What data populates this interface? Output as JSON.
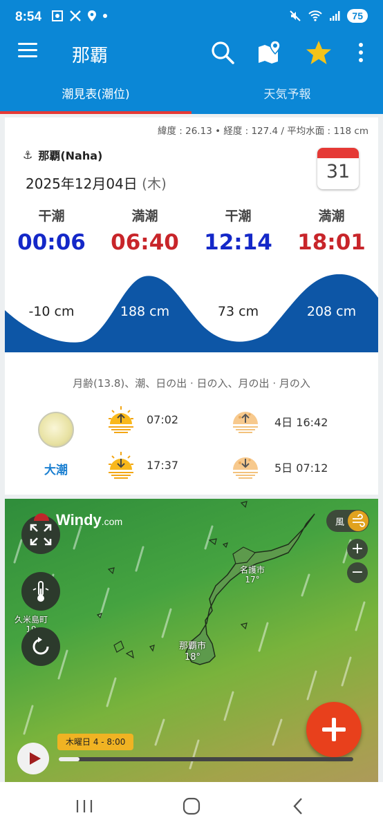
{
  "status_bar": {
    "time": "8:54",
    "battery": "75"
  },
  "app_bar": {
    "title": "那覇"
  },
  "tabs": [
    {
      "label": "潮見表(潮位)",
      "active": true
    },
    {
      "label": "天気予報",
      "active": false
    }
  ],
  "tide": {
    "coords_text": "緯度 : 26.13 • 経度 : 127.4 / 平均水面 : 118 cm",
    "station": "那覇(Naha)",
    "date": "2025年12月04日",
    "weekday": "(木)",
    "calendar_day": "31",
    "events": [
      {
        "label": "干潮",
        "time": "00:06",
        "kind": "low"
      },
      {
        "label": "満潮",
        "time": "06:40",
        "kind": "high"
      },
      {
        "label": "干潮",
        "time": "12:14",
        "kind": "low"
      },
      {
        "label": "満潮",
        "time": "18:01",
        "kind": "high"
      }
    ],
    "levels": [
      "-10 cm",
      "188 cm",
      "73 cm",
      "208 cm"
    ],
    "wave_color": "#0d56a6"
  },
  "astro": {
    "title": "月齢(13.8)、潮、日の出 · 日の入、月の出 · 月の入",
    "tide_type": "大潮",
    "sunrise": "07:02",
    "sunset": "17:37",
    "moonrise": "4日 16:42",
    "moonset": "5日 07:12"
  },
  "map": {
    "logo": "Windy",
    "logo_suffix": ".com",
    "wind_label": "風",
    "towns": [
      {
        "name": "名護市",
        "temp": "17°"
      },
      {
        "name": "那覇市",
        "temp": "18°"
      },
      {
        "name": "久米島町",
        "temp": "19"
      }
    ],
    "zoom_in": "+",
    "zoom_out": "−",
    "time_label": "木曜日 4 - 8:00"
  },
  "colors": {
    "brand": "#0b87d6",
    "tab_indicator": "#e53935",
    "low_tide": "#1428c8",
    "high_tide": "#c8252a",
    "fab": "#e8401c"
  }
}
